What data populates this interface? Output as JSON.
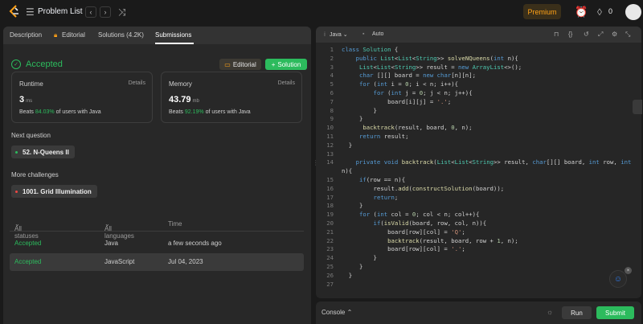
{
  "topbar": {
    "title": "Problem List",
    "premium": "Premium",
    "streak_count": "0",
    "icons": [
      "logo-icon",
      "list-icon",
      "prev-icon",
      "next-icon",
      "shuffle-icon",
      "timer-icon",
      "fire-icon"
    ]
  },
  "left_tabs": [
    {
      "label": "Description"
    },
    {
      "label": "Editorial"
    },
    {
      "label": "Solutions (4.2K)"
    },
    {
      "label": "Submissions"
    }
  ],
  "result": {
    "status": "Accepted",
    "editorial_btn": "Editorial",
    "solution_btn": "Solution"
  },
  "runtime": {
    "label": "Runtime",
    "details": "Details",
    "value": "3",
    "unit": "ms",
    "beats_prefix": "Beats",
    "beats_pct": "84.03%",
    "beats_suffix": "of users with Java"
  },
  "memory": {
    "label": "Memory",
    "details": "Details",
    "value": "43.79",
    "unit": "mb",
    "beats_prefix": "Beats",
    "beats_pct": "92.19%",
    "beats_suffix": "of users with Java"
  },
  "next_question": {
    "label": "Next question",
    "item": "52. N-Queens II"
  },
  "more_challenges": {
    "label": "More challenges",
    "item": "1001. Grid Illumination"
  },
  "submissions": {
    "headers": {
      "status": "All statuses",
      "language": "All languages",
      "time": "Time"
    },
    "rows": [
      {
        "status": "Accepted",
        "language": "Java",
        "time": "a few seconds ago"
      },
      {
        "status": "Accepted",
        "language": "JavaScript",
        "time": "Jul 04, 2023"
      }
    ]
  },
  "editor": {
    "language": "Java",
    "mode": "Auto"
  },
  "code_lines": [
    "class Solution {",
    "    public List<List<String>> solveNQueens(int n){",
    "     List<List<String>> result = new ArrayList<>();",
    "     char [][] board = new char[n][n];",
    "     for (int i = 0; i < n; i++){",
    "         for (int j = 0; j < n; j++){",
    "             board[i][j] = '.';",
    "         }",
    "     }",
    "      backtrack(result, board, 0, n);",
    "     return result;",
    "  }",
    "",
    "    private void backtrack(List<List<String>> result, char[][] board, int row, int",
    "n){",
    "     if(row == n){",
    "         result.add(constructSolution(board));",
    "         return;",
    "     }",
    "     for (int col = 0; col < n; col++){",
    "         if(isValid(board, row, col, n)){",
    "             board[row][col] = 'Q';",
    "             backtrack(result, board, row + 1, n);",
    "             board[row][col] = '.';",
    "         }",
    "     }",
    "  }",
    ""
  ],
  "line_numbers": [
    "1",
    "2",
    "3",
    "4",
    "5",
    "6",
    "7",
    "8",
    "9",
    "10",
    "11",
    "12",
    "13",
    "14",
    "",
    "15",
    "16",
    "17",
    "18",
    "19",
    "20",
    "21",
    "22",
    "23",
    "24",
    "25",
    "26",
    "27"
  ],
  "console": {
    "label": "Console",
    "run": "Run",
    "submit": "Submit"
  },
  "colors": {
    "accent_green": "#2cbb5d",
    "premium_orange": "#ffa116",
    "panel_bg": "#282828"
  }
}
